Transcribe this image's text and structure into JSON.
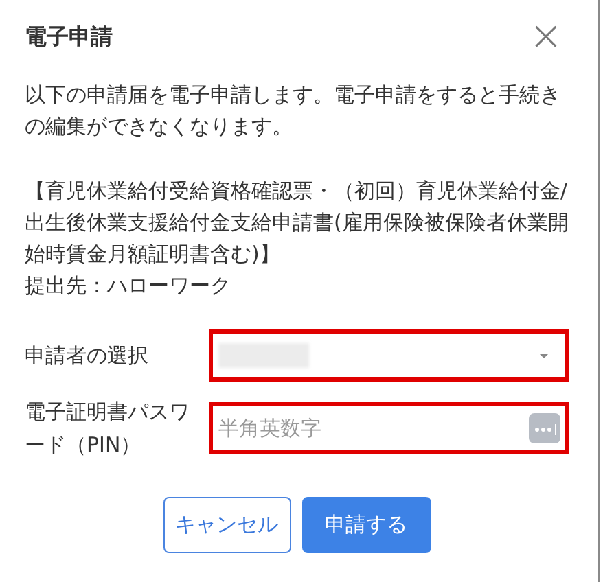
{
  "dialog": {
    "title": "電子申請",
    "close": "×"
  },
  "message": [
    "以下の申請届を電子申請します。電子申請をすると手続きの編集ができなくなります。",
    "【育児休業給付受給資格確認票・（初回）育児休業給付金/出生後休業支援給付金支給申請書(雇用保険被保険者休業開始時賃金月額証明書含む)】",
    "提出先：ハローワーク"
  ],
  "fields": [
    {
      "kind": "select",
      "label": "申請者の選択",
      "redacted": true,
      "highlighted": true
    },
    {
      "kind": "password",
      "label": "電子証明書パスワード（PIN）",
      "placeholder": "半角英数字",
      "highlighted": true
    }
  ],
  "buttons": [
    {
      "label": "キャンセル",
      "kind": "secondary"
    },
    {
      "label": "申請する",
      "kind": "primary"
    }
  ]
}
